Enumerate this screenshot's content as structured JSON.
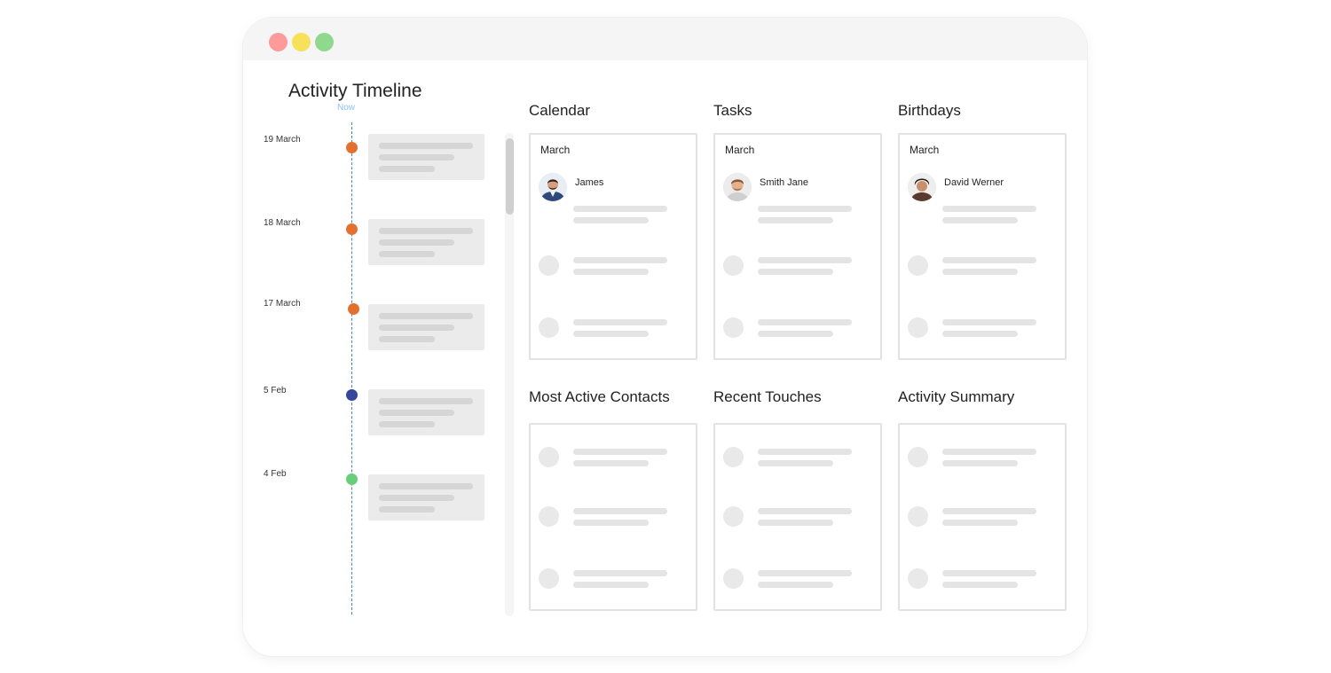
{
  "window": {
    "controls": [
      "close",
      "minimize",
      "maximize"
    ],
    "colors": {
      "close": "#fe9a9a",
      "minimize": "#f7e05a",
      "maximize": "#8fd98f"
    }
  },
  "timeline": {
    "title": "Activity Timeline",
    "now_label": "Now",
    "entries": [
      {
        "date": "19 March",
        "color": "#e4702f"
      },
      {
        "date": "18 March",
        "color": "#e4702f"
      },
      {
        "date": "17 March",
        "color": "#e4702f"
      },
      {
        "date": "5 Feb",
        "color": "#34479a"
      },
      {
        "date": "4 Feb",
        "color": "#67cf7a"
      }
    ]
  },
  "widgets": {
    "calendar": {
      "title": "Calendar",
      "month": "March",
      "person": "James"
    },
    "tasks": {
      "title": "Tasks",
      "month": "March",
      "person": "Smith Jane"
    },
    "birthdays": {
      "title": "Birthdays",
      "month": "March",
      "person": "David Werner"
    },
    "most_active": {
      "title": "Most Active Contacts"
    },
    "recent_touches": {
      "title": "Recent Touches"
    },
    "activity_summary": {
      "title": "Activity Summary"
    }
  }
}
